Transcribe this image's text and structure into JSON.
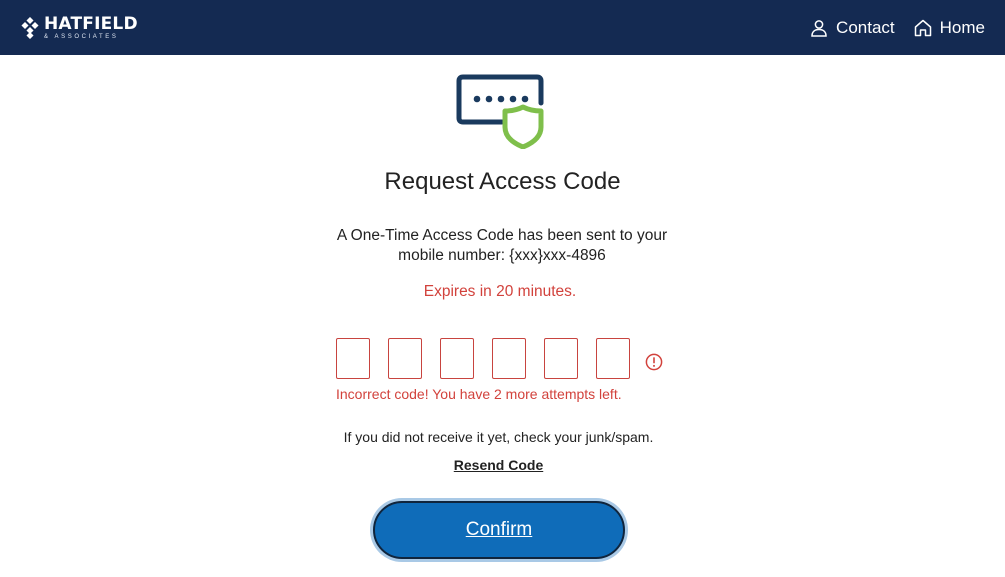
{
  "header": {
    "brand_name": "HATFIELD",
    "brand_sub": "& ASSOCIATES",
    "nav": {
      "contact_label": "Contact",
      "home_label": "Home"
    }
  },
  "main": {
    "title": "Request Access Code",
    "message_line1": "A One-Time Access Code has been sent to your",
    "message_line2": "mobile number: {xxx}xxx-4896",
    "expires": "Expires in 20 minutes.",
    "code_boxes": [
      "",
      "",
      "",
      "",
      "",
      ""
    ],
    "error": "Incorrect code! You have 2 more attempts left.",
    "hint": "If you did not receive it yet, check your junk/spam.",
    "resend_label": "Resend Code",
    "confirm_label": "Confirm"
  },
  "icons": {
    "brand": "diamond-cluster-logo-icon",
    "contact": "user-icon",
    "home": "home-icon",
    "hero": "password-shield-icon",
    "alert": "alert-circle-icon"
  },
  "colors": {
    "navbar": "#142a52",
    "error": "#d2423c",
    "button": "#0f6cb9",
    "shield": "#7fbf4b",
    "icon_navy": "#1a3a5e"
  }
}
